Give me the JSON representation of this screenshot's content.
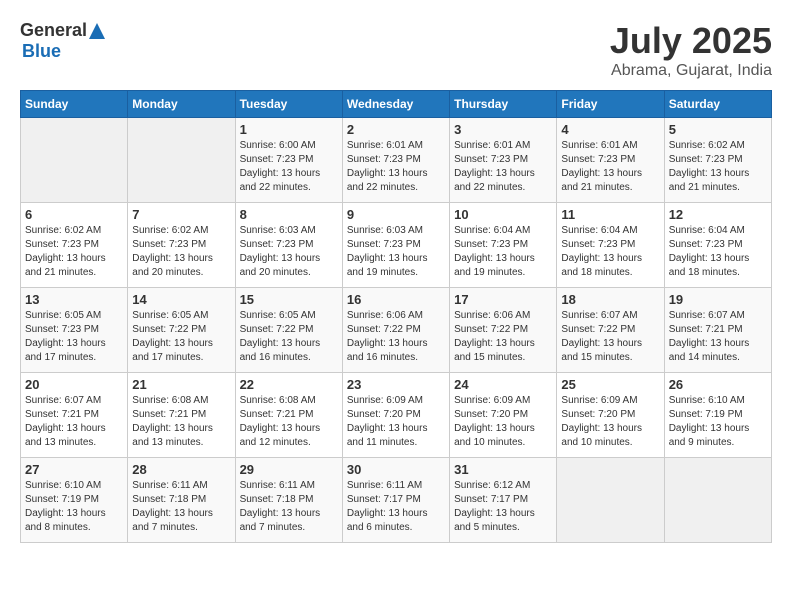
{
  "header": {
    "logo_general": "General",
    "logo_blue": "Blue",
    "title": "July 2025",
    "location": "Abrama, Gujarat, India"
  },
  "calendar": {
    "days_of_week": [
      "Sunday",
      "Monday",
      "Tuesday",
      "Wednesday",
      "Thursday",
      "Friday",
      "Saturday"
    ],
    "weeks": [
      [
        {
          "day": "",
          "info": ""
        },
        {
          "day": "",
          "info": ""
        },
        {
          "day": "1",
          "info": "Sunrise: 6:00 AM\nSunset: 7:23 PM\nDaylight: 13 hours\nand 22 minutes."
        },
        {
          "day": "2",
          "info": "Sunrise: 6:01 AM\nSunset: 7:23 PM\nDaylight: 13 hours\nand 22 minutes."
        },
        {
          "day": "3",
          "info": "Sunrise: 6:01 AM\nSunset: 7:23 PM\nDaylight: 13 hours\nand 22 minutes."
        },
        {
          "day": "4",
          "info": "Sunrise: 6:01 AM\nSunset: 7:23 PM\nDaylight: 13 hours\nand 21 minutes."
        },
        {
          "day": "5",
          "info": "Sunrise: 6:02 AM\nSunset: 7:23 PM\nDaylight: 13 hours\nand 21 minutes."
        }
      ],
      [
        {
          "day": "6",
          "info": "Sunrise: 6:02 AM\nSunset: 7:23 PM\nDaylight: 13 hours\nand 21 minutes."
        },
        {
          "day": "7",
          "info": "Sunrise: 6:02 AM\nSunset: 7:23 PM\nDaylight: 13 hours\nand 20 minutes."
        },
        {
          "day": "8",
          "info": "Sunrise: 6:03 AM\nSunset: 7:23 PM\nDaylight: 13 hours\nand 20 minutes."
        },
        {
          "day": "9",
          "info": "Sunrise: 6:03 AM\nSunset: 7:23 PM\nDaylight: 13 hours\nand 19 minutes."
        },
        {
          "day": "10",
          "info": "Sunrise: 6:04 AM\nSunset: 7:23 PM\nDaylight: 13 hours\nand 19 minutes."
        },
        {
          "day": "11",
          "info": "Sunrise: 6:04 AM\nSunset: 7:23 PM\nDaylight: 13 hours\nand 18 minutes."
        },
        {
          "day": "12",
          "info": "Sunrise: 6:04 AM\nSunset: 7:23 PM\nDaylight: 13 hours\nand 18 minutes."
        }
      ],
      [
        {
          "day": "13",
          "info": "Sunrise: 6:05 AM\nSunset: 7:23 PM\nDaylight: 13 hours\nand 17 minutes."
        },
        {
          "day": "14",
          "info": "Sunrise: 6:05 AM\nSunset: 7:22 PM\nDaylight: 13 hours\nand 17 minutes."
        },
        {
          "day": "15",
          "info": "Sunrise: 6:05 AM\nSunset: 7:22 PM\nDaylight: 13 hours\nand 16 minutes."
        },
        {
          "day": "16",
          "info": "Sunrise: 6:06 AM\nSunset: 7:22 PM\nDaylight: 13 hours\nand 16 minutes."
        },
        {
          "day": "17",
          "info": "Sunrise: 6:06 AM\nSunset: 7:22 PM\nDaylight: 13 hours\nand 15 minutes."
        },
        {
          "day": "18",
          "info": "Sunrise: 6:07 AM\nSunset: 7:22 PM\nDaylight: 13 hours\nand 15 minutes."
        },
        {
          "day": "19",
          "info": "Sunrise: 6:07 AM\nSunset: 7:21 PM\nDaylight: 13 hours\nand 14 minutes."
        }
      ],
      [
        {
          "day": "20",
          "info": "Sunrise: 6:07 AM\nSunset: 7:21 PM\nDaylight: 13 hours\nand 13 minutes."
        },
        {
          "day": "21",
          "info": "Sunrise: 6:08 AM\nSunset: 7:21 PM\nDaylight: 13 hours\nand 13 minutes."
        },
        {
          "day": "22",
          "info": "Sunrise: 6:08 AM\nSunset: 7:21 PM\nDaylight: 13 hours\nand 12 minutes."
        },
        {
          "day": "23",
          "info": "Sunrise: 6:09 AM\nSunset: 7:20 PM\nDaylight: 13 hours\nand 11 minutes."
        },
        {
          "day": "24",
          "info": "Sunrise: 6:09 AM\nSunset: 7:20 PM\nDaylight: 13 hours\nand 10 minutes."
        },
        {
          "day": "25",
          "info": "Sunrise: 6:09 AM\nSunset: 7:20 PM\nDaylight: 13 hours\nand 10 minutes."
        },
        {
          "day": "26",
          "info": "Sunrise: 6:10 AM\nSunset: 7:19 PM\nDaylight: 13 hours\nand 9 minutes."
        }
      ],
      [
        {
          "day": "27",
          "info": "Sunrise: 6:10 AM\nSunset: 7:19 PM\nDaylight: 13 hours\nand 8 minutes."
        },
        {
          "day": "28",
          "info": "Sunrise: 6:11 AM\nSunset: 7:18 PM\nDaylight: 13 hours\nand 7 minutes."
        },
        {
          "day": "29",
          "info": "Sunrise: 6:11 AM\nSunset: 7:18 PM\nDaylight: 13 hours\nand 7 minutes."
        },
        {
          "day": "30",
          "info": "Sunrise: 6:11 AM\nSunset: 7:17 PM\nDaylight: 13 hours\nand 6 minutes."
        },
        {
          "day": "31",
          "info": "Sunrise: 6:12 AM\nSunset: 7:17 PM\nDaylight: 13 hours\nand 5 minutes."
        },
        {
          "day": "",
          "info": ""
        },
        {
          "day": "",
          "info": ""
        }
      ]
    ]
  }
}
